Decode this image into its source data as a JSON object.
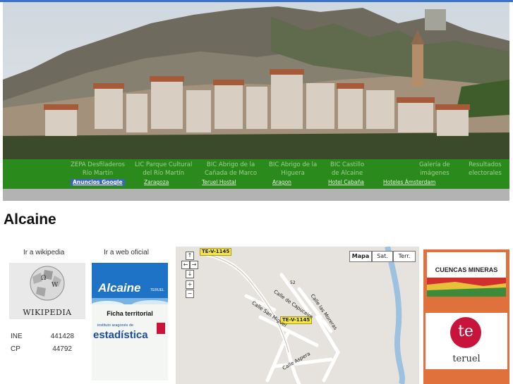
{
  "nav": {
    "top_items": [
      "ZEPA Desfiladeros\nRío Martín",
      "LIC Parque Cultural\ndel Río Martín",
      "BIC Abrigo de la\nCañada de Marco",
      "BIC Abrigo de la\nHiguera",
      "BIC Castillo\nde Alcaine",
      "Galería de\nimágenes",
      "Resultados\nelectorales"
    ],
    "ad_links": [
      "Anuncios Google",
      "Zaragoza",
      "Teruel Hostal",
      "Aragon",
      "Hotel Cabaña",
      "Hoteles Ámsterdam"
    ]
  },
  "page_title": "Alcaine",
  "links": {
    "wikipedia_label": "Ir a wikipedia",
    "web_label": "Ir a web oficial",
    "wikipedia_wordmark": "Wikipedia",
    "web_logo_text": "Alcaine",
    "web_logo_small": "TERUEL",
    "ficha_label": "Ficha territorial",
    "ficha_sub": "instituto aragonés de",
    "ficha_logo": "estadística"
  },
  "stats": [
    {
      "key": "INE",
      "value": "441428"
    },
    {
      "key": "CP",
      "value": "44792"
    }
  ],
  "map": {
    "types": [
      "Mapa",
      "Sat.",
      "Terr."
    ],
    "selected_type": "Mapa",
    "road_badges": [
      "TE-V-1145",
      "TE-V-1145"
    ],
    "streets": [
      "Calle de Capuceiro",
      "Calle San Miguel",
      "Calle las Moreras",
      "Calle Aspera"
    ],
    "marker_number": "52"
  },
  "ads": {
    "cuencas": "CUENCAS MINERAS",
    "teruel_mark": "te",
    "teruel": "teruel"
  },
  "colors": {
    "nav_green": "#2a8a1c",
    "nav_text": "#9fd08f",
    "active_link": "#3a66c0",
    "ad_orange": "#e0713c",
    "teruel_red": "#c8143a",
    "estadistica_blue": "#1d4d9a"
  }
}
